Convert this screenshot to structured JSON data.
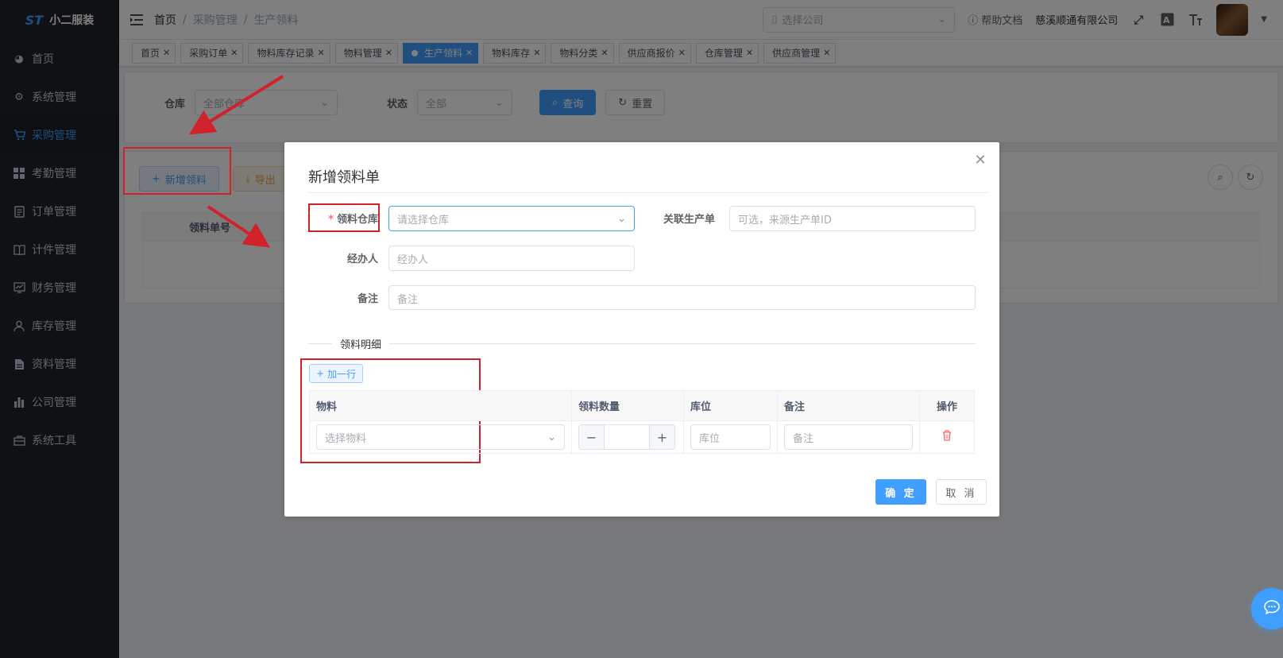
{
  "app": {
    "logo_mark": "ST",
    "name": "小二服装"
  },
  "sidebar": {
    "items": [
      {
        "label": "首页",
        "icon": "dashboard-icon"
      },
      {
        "label": "系统管理",
        "icon": "gear-icon"
      },
      {
        "label": "采购管理",
        "icon": "cart-icon"
      },
      {
        "label": "考勤管理",
        "icon": "grid-icon"
      },
      {
        "label": "订单管理",
        "icon": "order-icon"
      },
      {
        "label": "计件管理",
        "icon": "book-icon"
      },
      {
        "label": "财务管理",
        "icon": "chart-icon"
      },
      {
        "label": "库存管理",
        "icon": "user-icon"
      },
      {
        "label": "资料管理",
        "icon": "document-icon"
      },
      {
        "label": "公司管理",
        "icon": "bar-chart-icon"
      },
      {
        "label": "系统工具",
        "icon": "toolbox-icon"
      }
    ],
    "active_index": 2
  },
  "topbar": {
    "breadcrumb": [
      "首页",
      "采购管理",
      "生产领料"
    ],
    "company_placeholder": "选择公司",
    "help_label": "帮助文档",
    "company_name": "慈溪顺通有限公司"
  },
  "tags": [
    {
      "label": "首页",
      "active": false
    },
    {
      "label": "采购订单",
      "active": false
    },
    {
      "label": "物料库存记录",
      "active": false
    },
    {
      "label": "物料管理",
      "active": false
    },
    {
      "label": "生产领料",
      "active": true
    },
    {
      "label": "物料库存",
      "active": false
    },
    {
      "label": "物料分类",
      "active": false
    },
    {
      "label": "供应商报价",
      "active": false
    },
    {
      "label": "仓库管理",
      "active": false
    },
    {
      "label": "供应商管理",
      "active": false
    }
  ],
  "search": {
    "warehouse_label": "仓库",
    "warehouse_value": "全部仓库",
    "status_label": "状态",
    "status_value": "全部",
    "query_label": "查询",
    "reset_label": "重置"
  },
  "toolbar": {
    "add_label": "新增领料",
    "export_label": "导出"
  },
  "list_table": {
    "col1": "领料单号"
  },
  "dialog": {
    "title": "新增领料单",
    "warehouse_label": "领料仓库",
    "warehouse_placeholder": "请选择仓库",
    "order_label": "关联生产单",
    "order_placeholder": "可选，来源生产单ID",
    "handler_label": "经办人",
    "handler_placeholder": "经办人",
    "remark_label": "备注",
    "remark_placeholder": "备注",
    "section_title": "领料明细",
    "add_row_label": "加一行",
    "columns": [
      "物料",
      "领料数量",
      "库位",
      "备注",
      "操作"
    ],
    "row": {
      "material_placeholder": "选择物料",
      "location_placeholder": "库位",
      "remark_placeholder": "备注"
    },
    "ok_label": "确 定",
    "cancel_label": "取 消"
  },
  "colors": {
    "primary": "#409eff",
    "sidebar_bg": "#1f2329",
    "annotation": "#d0222a",
    "danger": "#f56c6c"
  }
}
